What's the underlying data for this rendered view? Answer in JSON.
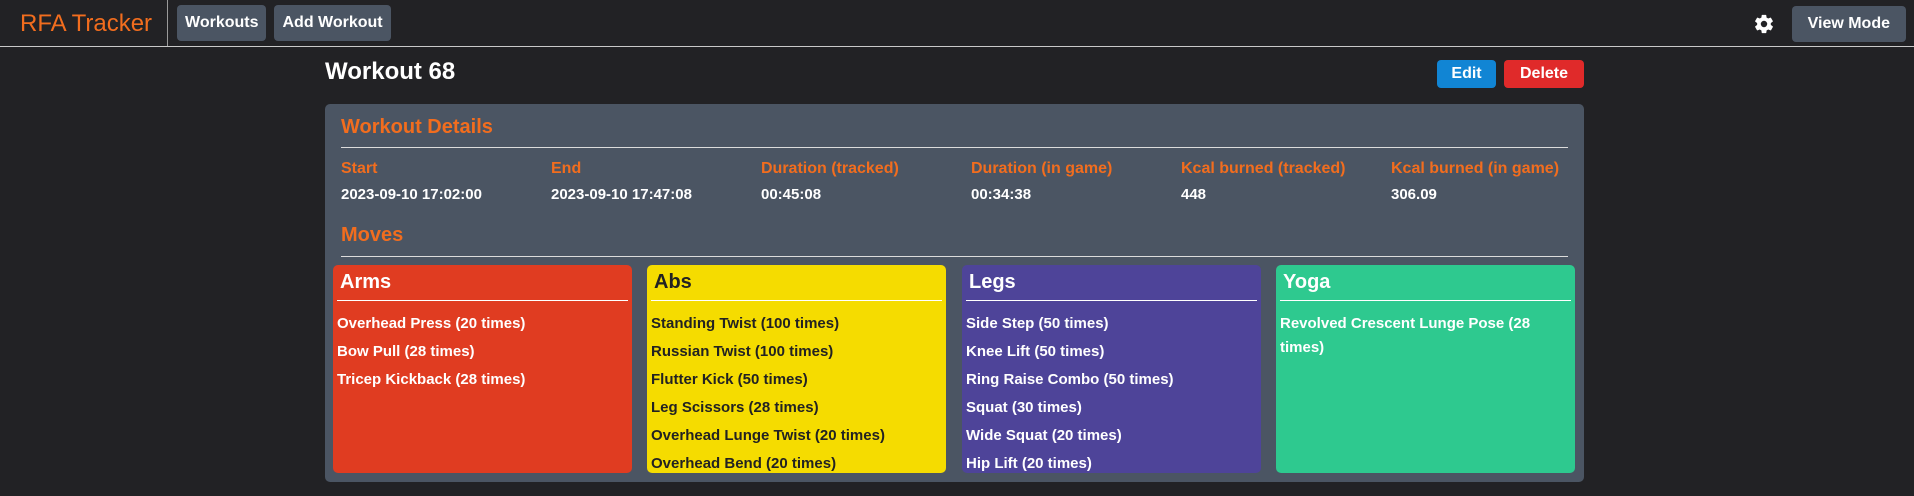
{
  "navbar": {
    "brand": "RFA Tracker",
    "workouts_label": "Workouts",
    "add_workout_label": "Add Workout",
    "settings_icon": "gear-icon",
    "view_mode_label": "View Mode"
  },
  "page": {
    "title": "Workout 68",
    "edit_label": "Edit",
    "delete_label": "Delete"
  },
  "details": {
    "section_title": "Workout Details",
    "stats": [
      {
        "label": "Start",
        "value": "2023-09-10 17:02:00"
      },
      {
        "label": "End",
        "value": "2023-09-10 17:47:08"
      },
      {
        "label": "Duration (tracked)",
        "value": "00:45:08"
      },
      {
        "label": "Duration (in game)",
        "value": "00:34:38"
      },
      {
        "label": "Kcal burned (tracked)",
        "value": "448"
      },
      {
        "label": "Kcal burned (in game)",
        "value": "306.09"
      }
    ]
  },
  "moves": {
    "section_title": "Moves",
    "categories": [
      {
        "title": "Arms",
        "color": "#e03c21",
        "items": [
          "Overhead Press (20 times)",
          "Bow Pull (28 times)",
          "Tricep Kickback (28 times)"
        ]
      },
      {
        "title": "Abs",
        "color": "#f5dc00",
        "items": [
          "Standing Twist (100 times)",
          "Russian Twist (100 times)",
          "Flutter Kick (50 times)",
          "Leg Scissors (28 times)",
          "Overhead Lunge Twist (20 times)",
          "Overhead Bend (20 times)"
        ]
      },
      {
        "title": "Legs",
        "color": "#4e4499",
        "items": [
          "Side Step (50 times)",
          "Knee Lift (50 times)",
          "Ring Raise Combo (50 times)",
          "Squat (30 times)",
          "Wide Squat (20 times)",
          "Hip Lift (20 times)"
        ]
      },
      {
        "title": "Yoga",
        "color": "#2ec98f",
        "items": [
          "Revolved Crescent Lunge Pose (28 times)"
        ]
      }
    ]
  }
}
